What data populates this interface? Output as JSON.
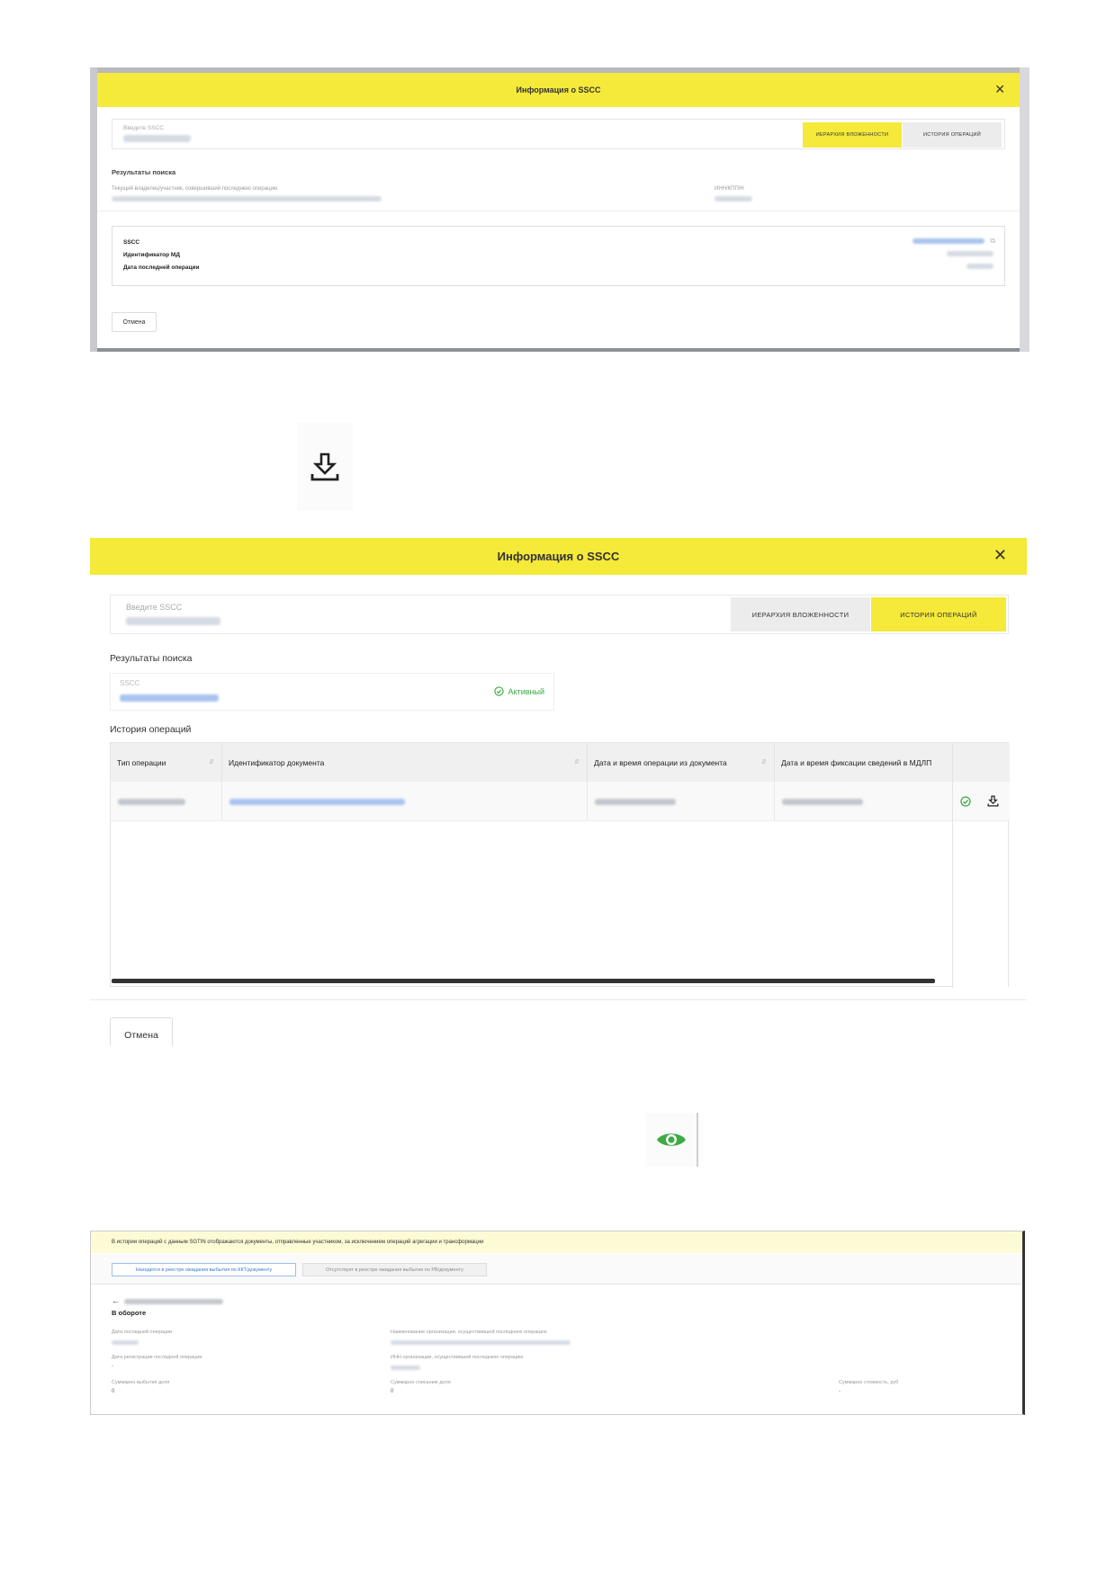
{
  "shot1": {
    "title": "Информация о SSCC",
    "close": "✕",
    "search_label": "Введите SSCC",
    "tabs": [
      "ИЕРАРХИЯ ВЛОЖЕННОСТИ",
      "ИСТОРИЯ ОПЕРАЦИЙ"
    ],
    "results_title": "Результаты поиска",
    "owner_label": "Текущий владелец/участник, совершивший последнюю операцию",
    "inn_label": "ИНН/КПП/Н",
    "card": {
      "sscc_label": "SSCC",
      "md_label": "Идентификатор МД",
      "date_label": "Дата последней операции"
    },
    "cancel": "Отмена"
  },
  "download_icon": "download-icon",
  "shot2": {
    "title": "Информация о SSCC",
    "close": "✕",
    "search_label": "Введите SSCC",
    "tabs": [
      "ИЕРАРХИЯ ВЛОЖЕННОСТИ",
      "ИСТОРИЯ ОПЕРАЦИЙ"
    ],
    "active_tab": 1,
    "results_title": "Результаты поиска",
    "sscc_label": "SSCC",
    "status": "Активный",
    "history_title": "История операций",
    "columns": [
      "Тип операции",
      "Идентификатор документа",
      "Дата и время операции из документа",
      "Дата и время фиксации сведений в МДЛП"
    ],
    "cancel": "Отмена",
    "colors": {
      "accent": "#f5e93a",
      "success": "#3cab44",
      "link": "#3a7bc6"
    }
  },
  "eye_icon": "eye-icon",
  "shot3": {
    "notice": "В истории операций с данным SGTIN отображаются документы, отправленные участником, за исключением операций агрегации и трансформации",
    "btn_registry": "Находится в реестре ожидания выбытия по ККТ/документу",
    "btn_absent": "Отсутствует в реестре ожидания выбытия по РВ/документу",
    "back": "←",
    "state": "В обороте",
    "fields": {
      "last_op_date": "Дата последней операции",
      "reg_date": "Дата регистрации последней операции",
      "reg_date_val": "-",
      "outflow": "Суммарно выбытия доля",
      "outflow_val": "0",
      "org_name": "Наименование организации, осуществившей последнюю операцию",
      "org_inn": "ИНН организации, осуществившей последнюю операцию",
      "writeoff": "Суммарно списанию доля",
      "writeoff_val": "0",
      "cost": "Суммарно стоимость, руб",
      "cost_val": "-"
    }
  }
}
